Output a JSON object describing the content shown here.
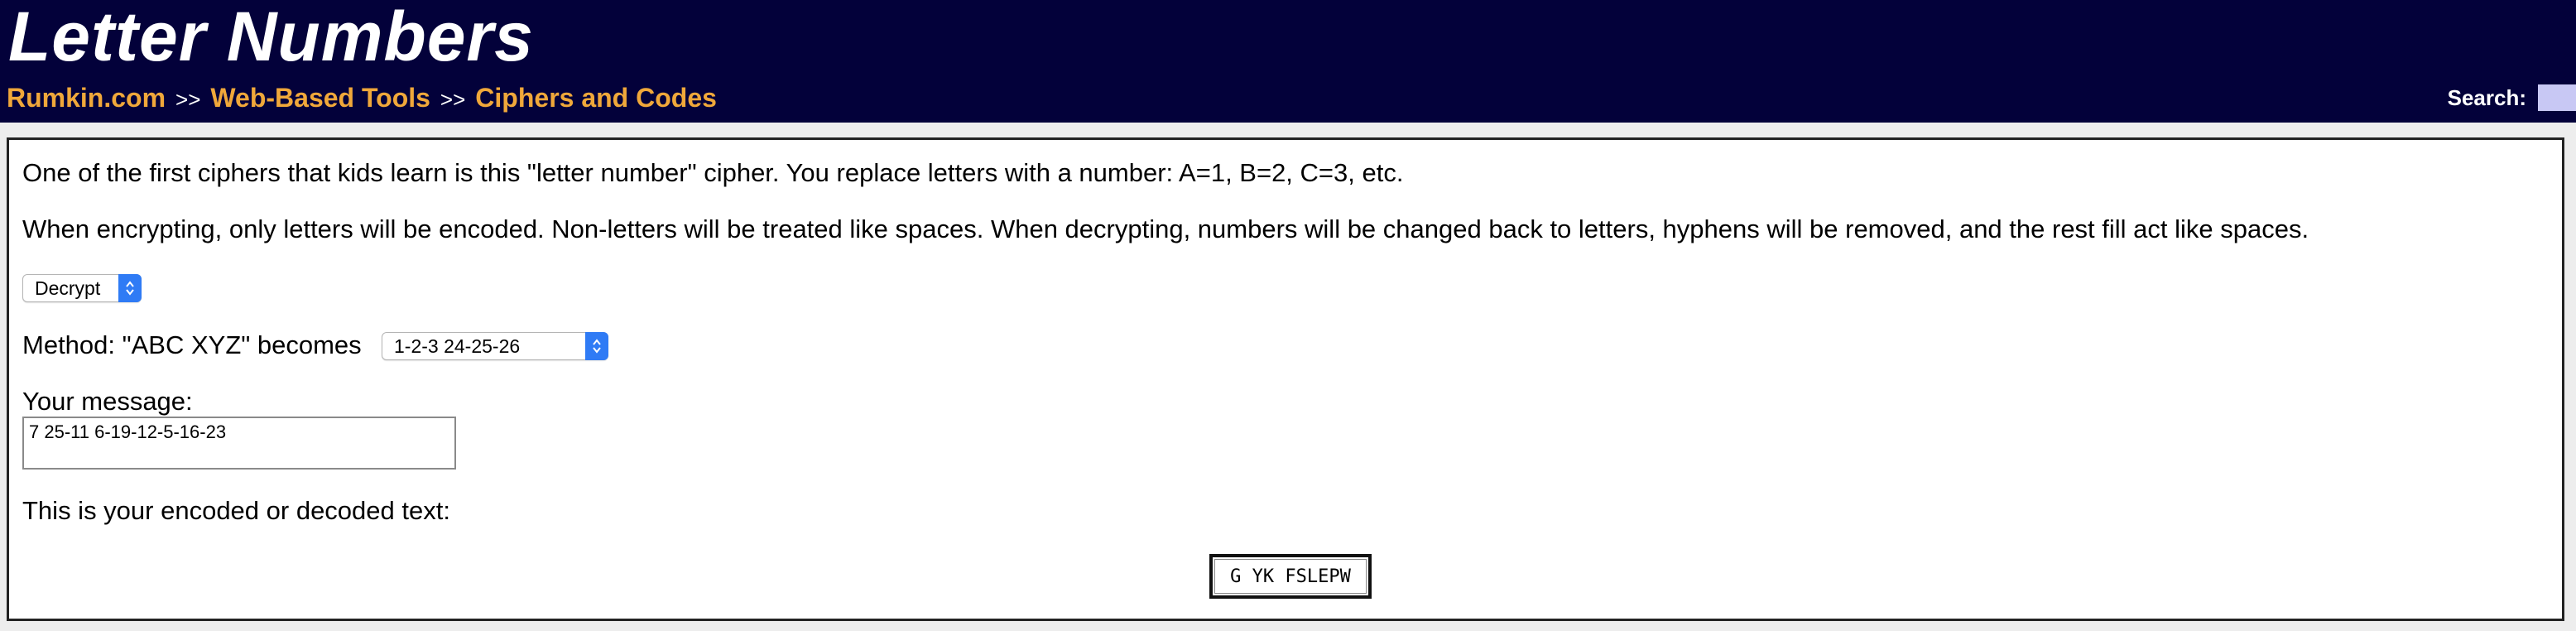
{
  "header": {
    "title": "Letter Numbers",
    "breadcrumb": [
      {
        "label": "Rumkin.com"
      },
      {
        "label": "Web-Based Tools"
      },
      {
        "label": "Ciphers and Codes"
      }
    ],
    "breadcrumb_separator": ">>",
    "search_label": "Search:"
  },
  "main": {
    "intro": "One of the first ciphers that kids learn is this \"letter number\" cipher. You replace letters with a number: A=1, B=2, C=3, etc.",
    "rules": "When encrypting, only letters will be encoded. Non-letters will be treated like spaces. When decrypting, numbers will be changed back to letters, hyphens will be removed, and the rest fill act like spaces.",
    "mode_select": {
      "value": "Decrypt"
    },
    "method_label": "Method: \"ABC XYZ\" becomes",
    "method_select": {
      "value": "1-2-3 24-25-26"
    },
    "message_label": "Your message:",
    "message_value": "7 25-11 6-19-12-5-16-23",
    "result_label": "This is your encoded or decoded text:",
    "result_value": "G YK FSLEPW"
  },
  "colors": {
    "header_bg": "#03013a",
    "breadcrumb_link": "#f0a83a",
    "select_accent": "#2f7bf5",
    "search_bg": "#c8c8f4"
  }
}
